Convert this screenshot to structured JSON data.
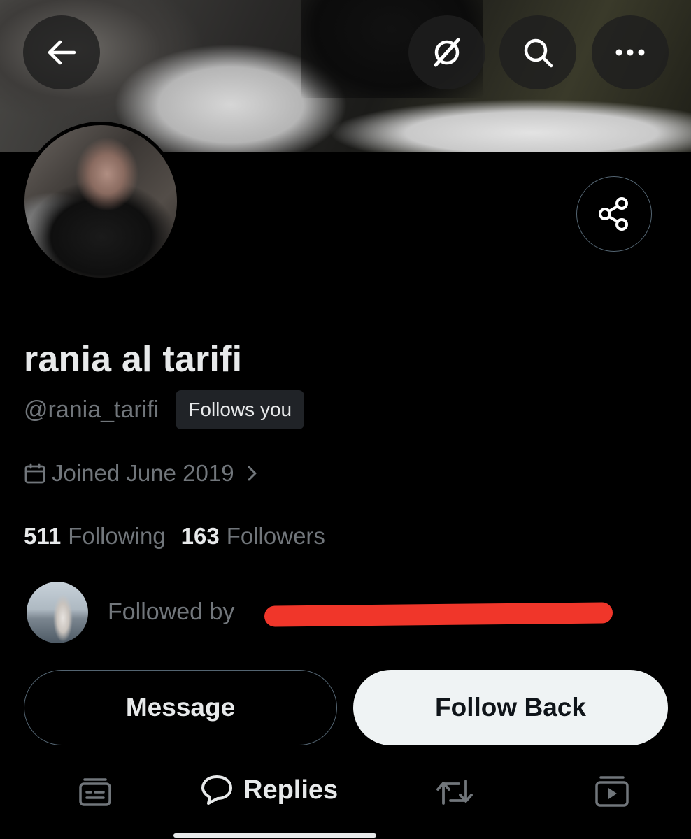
{
  "profile": {
    "name": "rania al tarifi",
    "handle": "@rania_tarifi",
    "follows_you_badge": "Follows you",
    "joined": "Joined June 2019"
  },
  "stats": {
    "following_count": "511",
    "following_label": "Following",
    "followers_count": "163",
    "followers_label": "Followers"
  },
  "followed_by": {
    "text": "Followed by"
  },
  "actions": {
    "message_label": "Message",
    "follow_back_label": "Follow Back"
  },
  "tabs": {
    "replies_label": "Replies"
  },
  "icons": {
    "back": "back-arrow-icon",
    "grok": "grok-icon",
    "search": "search-icon",
    "more": "more-icon",
    "share": "share-icon",
    "calendar": "calendar-icon",
    "chevron": "chevron-right-icon",
    "posts_tab": "posts-icon",
    "replies_tab": "speech-bubble-icon",
    "reposts_tab": "repost-icon",
    "media_tab": "video-icon"
  },
  "colors": {
    "background": "#000000",
    "primary_text": "#e7e9ea",
    "secondary_text": "#71767b",
    "follow_button_bg": "#eff3f4",
    "redaction": "#f0362a"
  }
}
